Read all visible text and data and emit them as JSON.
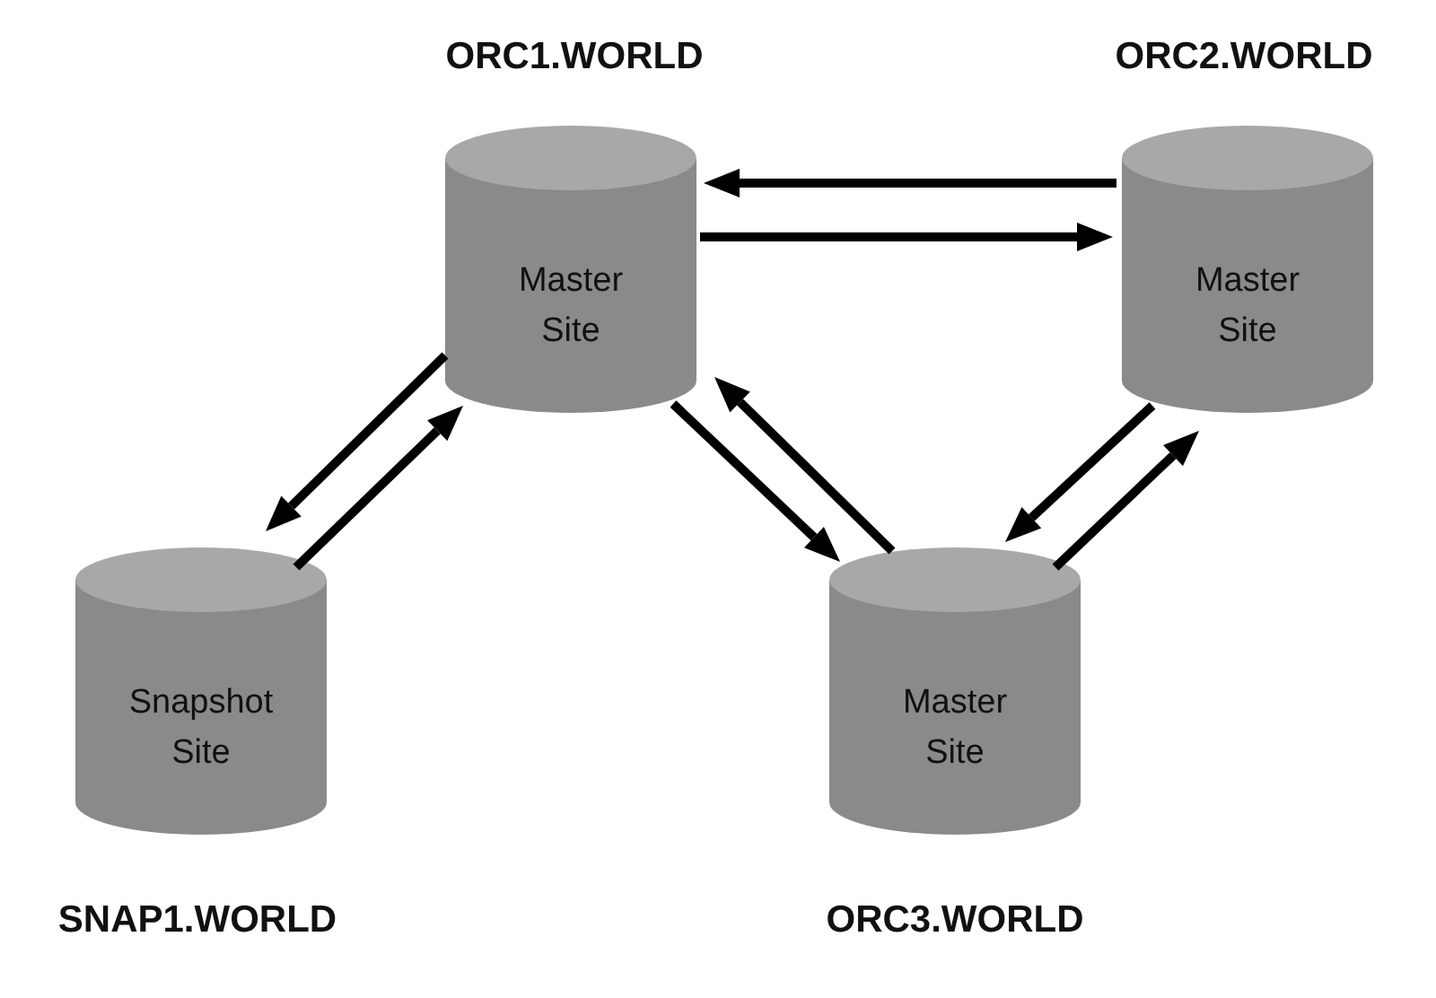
{
  "nodes": [
    {
      "name": "ORC1.WORLD",
      "type": "Master Site"
    },
    {
      "name": "ORC2.WORLD",
      "type": "Master Site"
    },
    {
      "name": "SNAP1.WORLD",
      "type": "Snapshot Site"
    },
    {
      "name": "ORC3.WORLD",
      "type": "Master Site"
    }
  ]
}
